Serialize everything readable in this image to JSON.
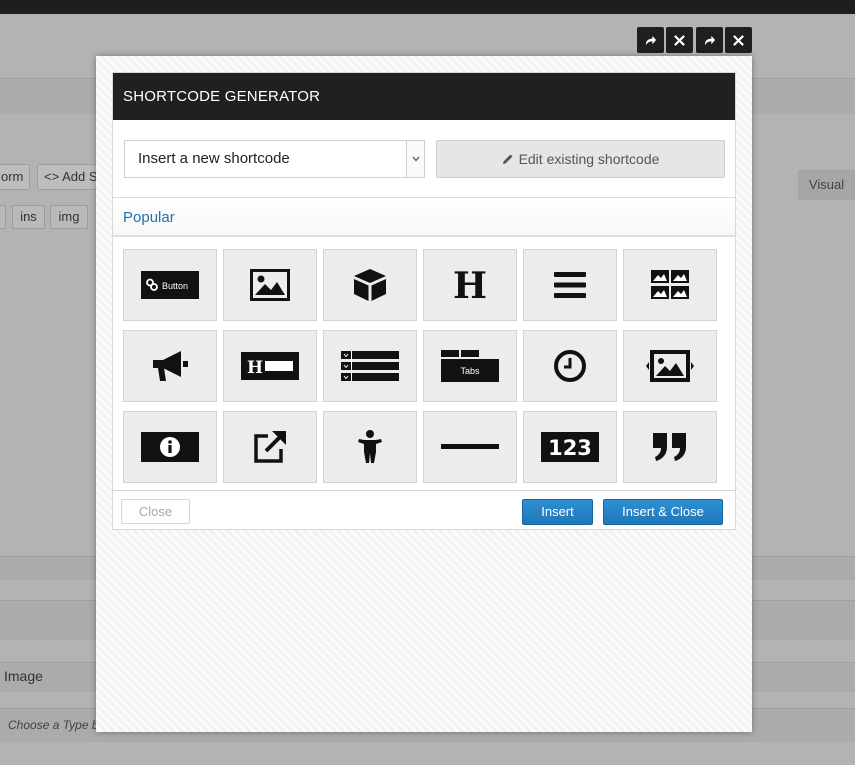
{
  "background": {
    "buttons": [
      "orm",
      "Add S"
    ],
    "quicktags": [
      "ins",
      "img"
    ],
    "visual_tab": "Visual",
    "field_label": "Image",
    "field_hint": "Choose a Type bas"
  },
  "window_controls": [
    "redo-arrow-icon",
    "close-icon",
    "redo-arrow-icon",
    "close-icon"
  ],
  "modal": {
    "title": "SHORTCODE GENERATOR",
    "select_value": "Insert a new shortcode",
    "edit_button": "Edit existing shortcode",
    "section": "Popular",
    "tiles": [
      {
        "icon": "button-icon",
        "label": "Button"
      },
      {
        "icon": "image-icon"
      },
      {
        "icon": "box-icon"
      },
      {
        "icon": "heading-icon",
        "label": "H"
      },
      {
        "icon": "menu-bars-icon"
      },
      {
        "icon": "gallery-icon"
      },
      {
        "icon": "megaphone-icon"
      },
      {
        "icon": "heading-box-icon",
        "label": "H"
      },
      {
        "icon": "list-icon"
      },
      {
        "icon": "tabs-icon",
        "label": "Tabs"
      },
      {
        "icon": "clock-icon"
      },
      {
        "icon": "image-slider-icon"
      },
      {
        "icon": "info-box-icon"
      },
      {
        "icon": "external-link-icon"
      },
      {
        "icon": "person-icon"
      },
      {
        "icon": "divider-icon"
      },
      {
        "icon": "counter-icon",
        "label": "123"
      },
      {
        "icon": "quote-icon"
      }
    ],
    "close_button": "Close",
    "insert_button": "Insert",
    "insert_close_button": "Insert & Close"
  }
}
